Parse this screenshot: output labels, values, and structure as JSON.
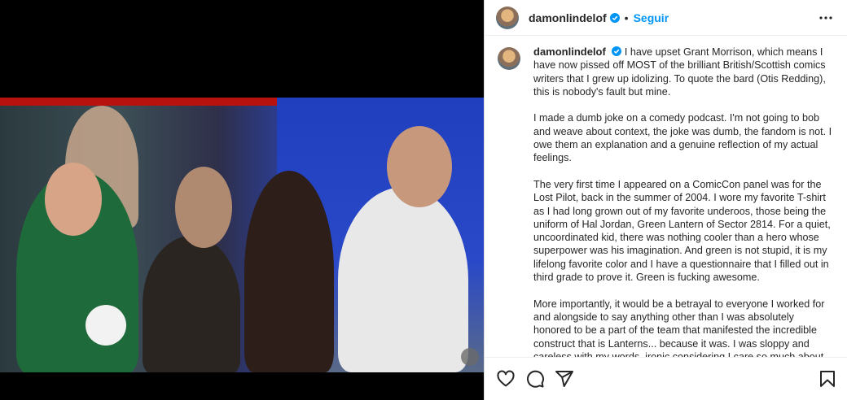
{
  "post": {
    "username": "damonlindelof",
    "follow_label": "Seguir",
    "separator": "•",
    "caption": [
      "I have upset Grant Morrison, which means I have now pissed off MOST of the brilliant British/Scottish comics writers that I grew up idolizing. To quote the bard (Otis Redding), this is nobody's fault but mine.",
      "I made a dumb joke on a comedy podcast. I'm not going to bob and weave about context, the joke was dumb, the fandom is not. I owe them an explanation and a genuine reflection of my actual feelings.",
      "The very first time I appeared on a ComicCon panel was for the Lost Pilot, back in the summer of 2004. I wore my favorite T-shirt as I had long grown out of my favorite underoos, those being the uniform of Hal Jordan, Green Lantern of Sector 2814. For a quiet, uncoordinated kid, there was nothing cooler than a hero whose superpower was his imagination. And green is not stupid, it is my lifelong favorite color and I have a questionnaire that I filled out in third grade to prove it. Green is fucking awesome.",
      "More importantly, it would be a betrayal to everyone I worked for and alongside to say anything other than I was absolutely honored to be a part of the team that manifested the incredible construct that is Lanterns... because it was. I was sloppy and careless with my words, ironic considering I care so much about"
    ]
  },
  "colors": {
    "accent": "#0095f6",
    "verified": "#0095f6",
    "text": "#262626"
  },
  "icons": [
    "ellipsis-icon",
    "verified-badge-icon",
    "heart-icon",
    "comment-icon",
    "share-icon",
    "bookmark-icon"
  ]
}
